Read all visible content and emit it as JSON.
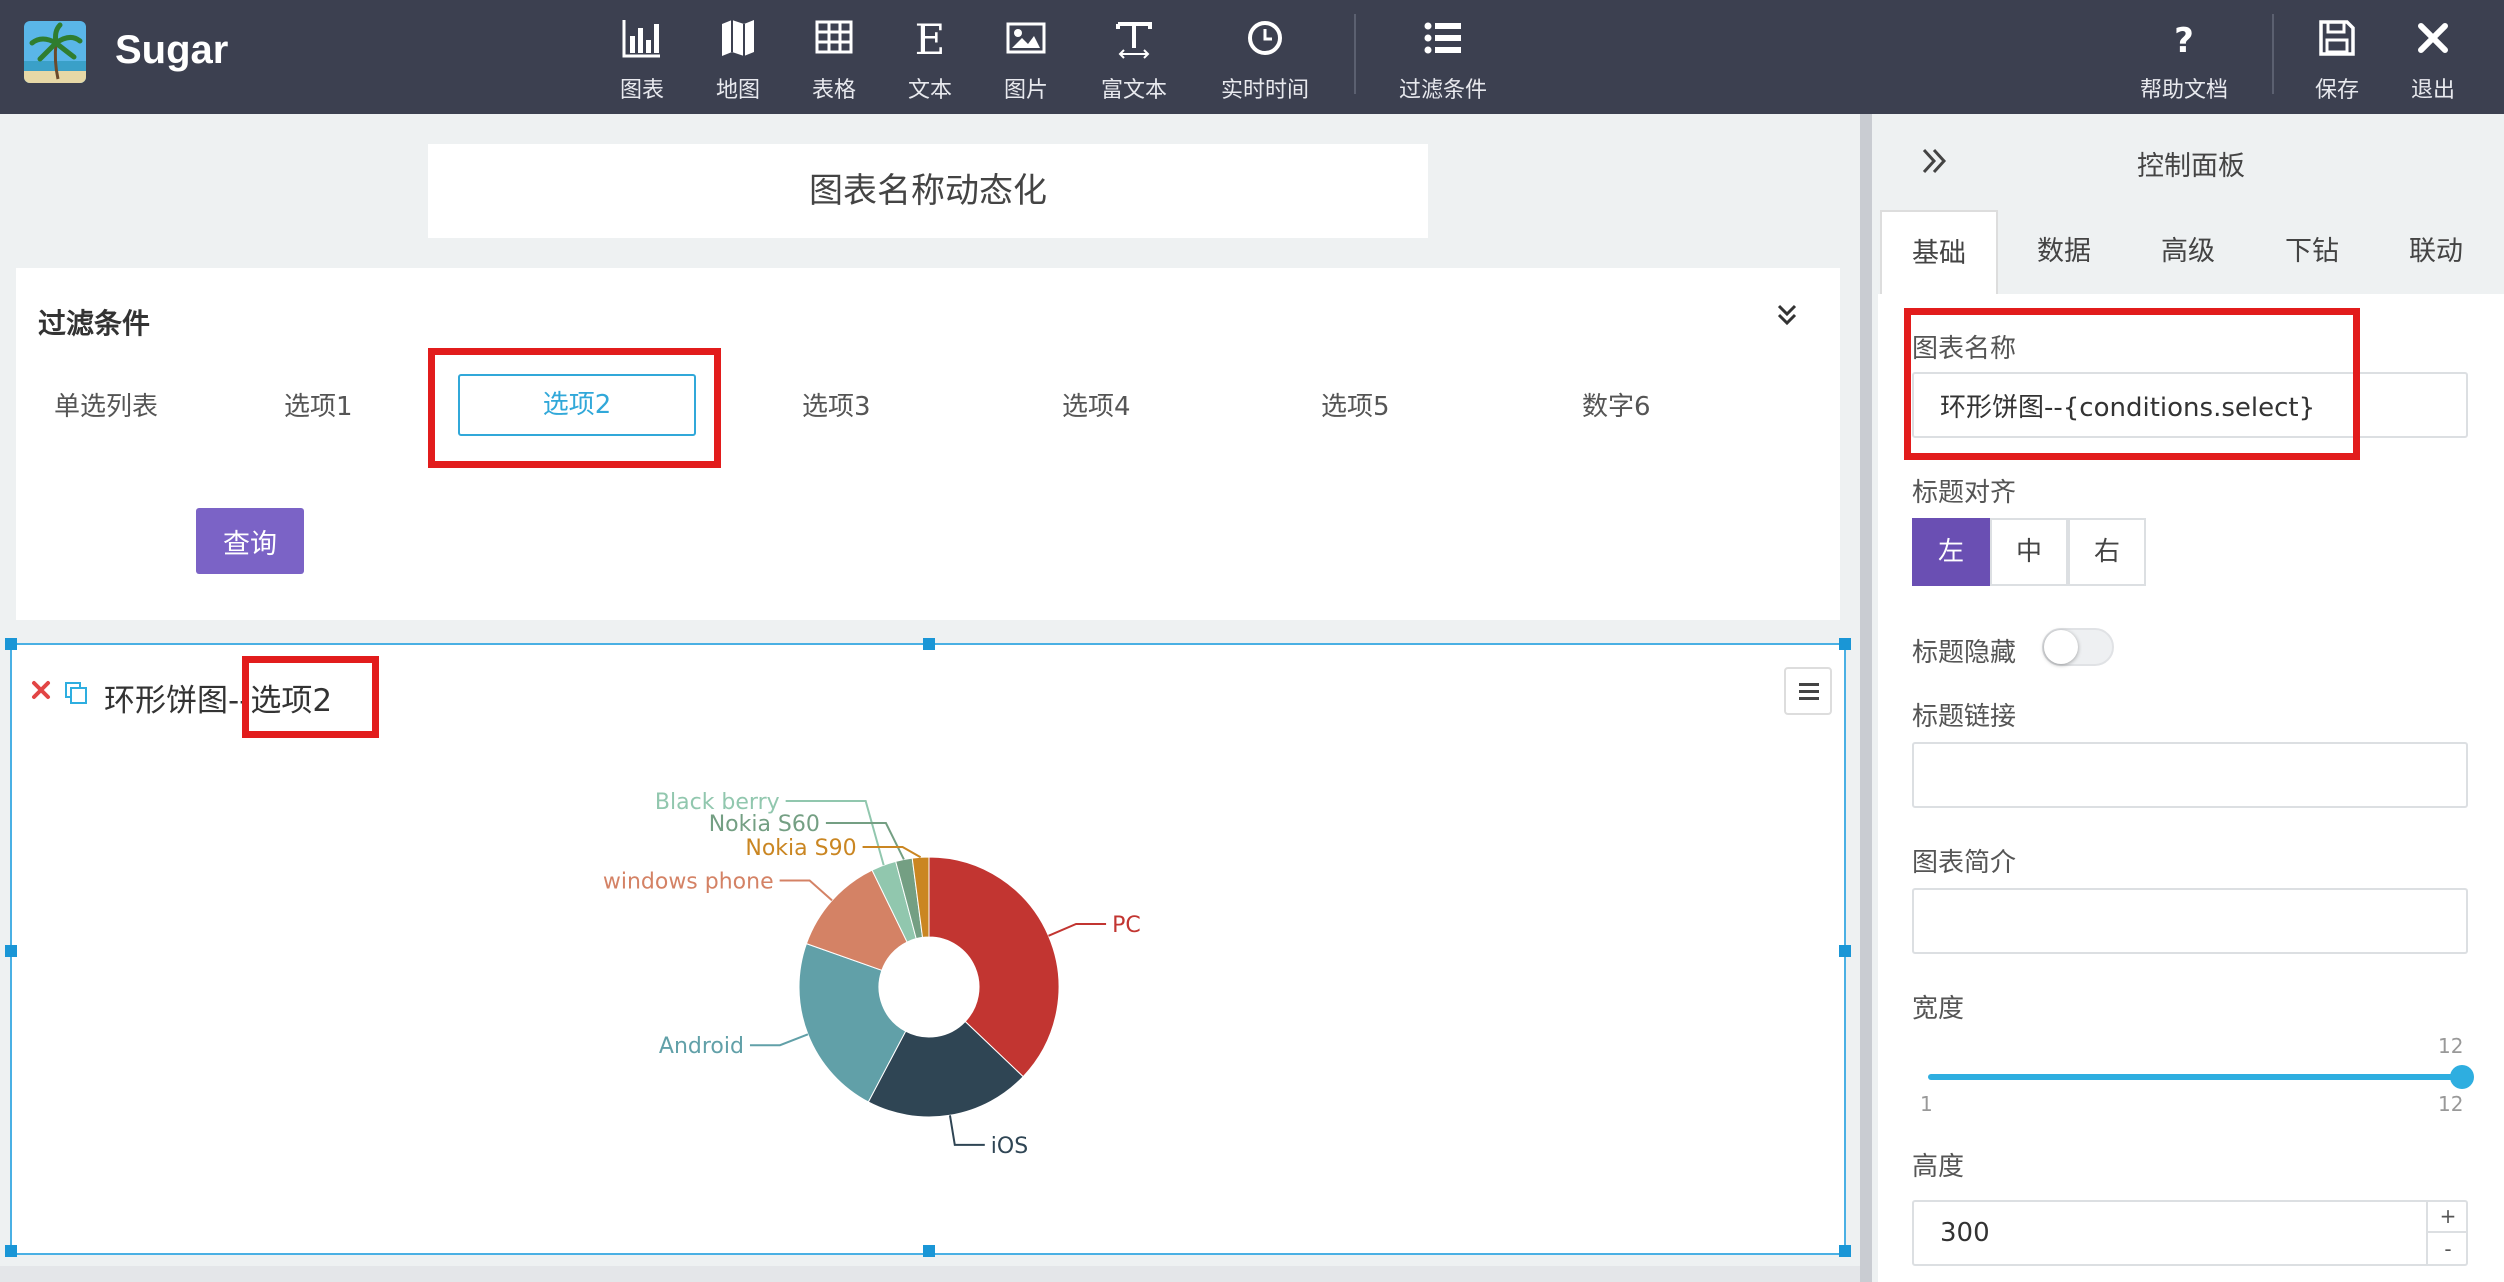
{
  "app": {
    "name": "Sugar"
  },
  "toolbar": {
    "items": [
      {
        "label": "图表",
        "icon": "bar-chart-icon"
      },
      {
        "label": "地图",
        "icon": "map-icon"
      },
      {
        "label": "表格",
        "icon": "table-icon"
      },
      {
        "label": "文本",
        "icon": "text-icon"
      },
      {
        "label": "图片",
        "icon": "image-icon"
      },
      {
        "label": "富文本",
        "icon": "rich-text-icon"
      },
      {
        "label": "实时时间",
        "icon": "clock-icon"
      },
      {
        "label": "过滤条件",
        "icon": "list-icon"
      }
    ],
    "right": [
      {
        "label": "帮助文档",
        "icon": "question-icon"
      },
      {
        "label": "保存",
        "icon": "save-icon"
      },
      {
        "label": "退出",
        "icon": "close-icon"
      }
    ]
  },
  "page": {
    "title": "图表名称动态化"
  },
  "filter": {
    "title": "过滤条件",
    "label": "单选列表",
    "options": [
      "选项1",
      "选项2",
      "选项3",
      "选项4",
      "选项5",
      "数字6"
    ],
    "selected": "选项2",
    "query_label": "查询"
  },
  "chart_widget": {
    "title_prefix": "环形饼图--",
    "title_value": "选项2"
  },
  "chart_data": {
    "type": "pie",
    "donut": true,
    "categories": [
      "PC",
      "iOS",
      "Android",
      "windows phone",
      "Black berry",
      "Nokia S60",
      "Nokia S90"
    ],
    "values": [
      36,
      20,
      22,
      12,
      3,
      2,
      2
    ],
    "colors": [
      "#c23531",
      "#2f4554",
      "#61a0a8",
      "#d48265",
      "#91c7ae",
      "#749f83",
      "#ca8622"
    ],
    "legend": "none"
  },
  "panel": {
    "title": "控制面板",
    "tabs": [
      "基础",
      "数据",
      "高级",
      "下钻",
      "联动"
    ],
    "active_tab": "基础",
    "chart_name_label": "图表名称",
    "chart_name_value": "环形饼图--{conditions.select}",
    "align_label": "标题对齐",
    "align_options": [
      "左",
      "中",
      "右"
    ],
    "align_active": "左",
    "hide_label": "标题隐藏",
    "hide_value": false,
    "link_label": "标题链接",
    "link_value": "",
    "desc_label": "图表简介",
    "desc_value": "",
    "width_label": "宽度",
    "width_min": "1",
    "width_max": "12",
    "width_value": "12",
    "height_label": "高度",
    "height_value": "300",
    "step_up": "+",
    "step_down": "-"
  }
}
